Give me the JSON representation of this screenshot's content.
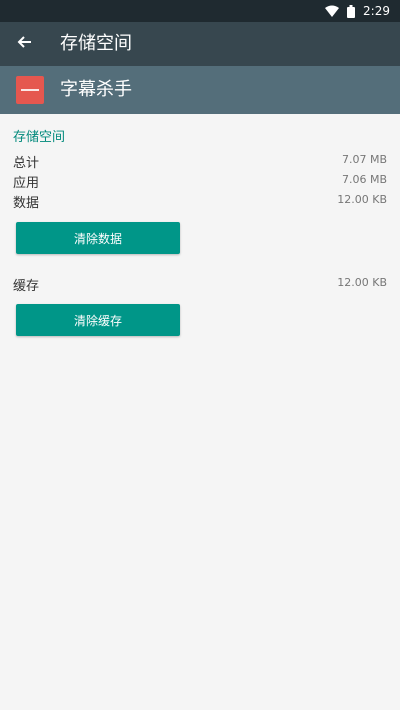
{
  "status_bar": {
    "time": "2:29"
  },
  "app_bar": {
    "title": "存储空间"
  },
  "app_header": {
    "app_name": "字幕杀手"
  },
  "storage": {
    "section_title": "存储空间",
    "rows": [
      {
        "label": "总计",
        "value": "7.07 MB"
      },
      {
        "label": "应用",
        "value": "7.06 MB"
      },
      {
        "label": "数据",
        "value": "12.00 KB"
      }
    ],
    "clear_data_label": "清除数据"
  },
  "cache": {
    "label": "缓存",
    "value": "12.00 KB",
    "clear_cache_label": "清除缓存"
  }
}
